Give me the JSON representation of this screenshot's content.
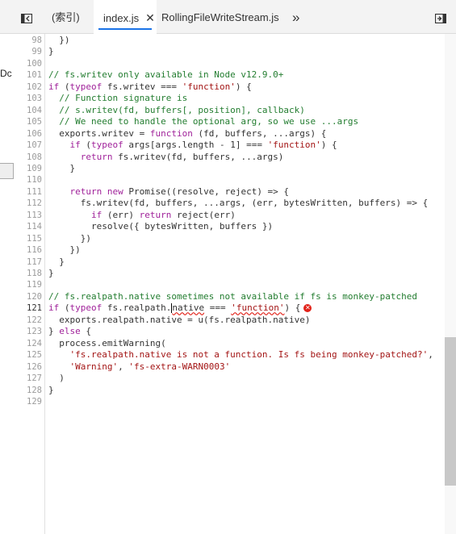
{
  "tabs": [
    {
      "label": "(索引)",
      "active": false
    },
    {
      "label": "index.js",
      "active": true
    },
    {
      "label": "RollingFileWriteStream.js",
      "active": false
    }
  ],
  "tab_overflow_glyph": "»",
  "left_panel_text": "Dc",
  "lines": [
    {
      "n": "98",
      "t": "  })"
    },
    {
      "n": "99",
      "t": "}"
    },
    {
      "n": "100",
      "t": ""
    },
    {
      "n": "101",
      "t": "// fs.writev only available in Node v12.9.0+"
    },
    {
      "n": "102",
      "t": "if (typeof fs.writev === 'function') {"
    },
    {
      "n": "103",
      "t": "  // Function signature is"
    },
    {
      "n": "104",
      "t": "  // s.writev(fd, buffers[, position], callback)"
    },
    {
      "n": "105",
      "t": "  // We need to handle the optional arg, so we use ...args"
    },
    {
      "n": "106",
      "t": "  exports.writev = function (fd, buffers, ...args) {"
    },
    {
      "n": "107",
      "t": "    if (typeof args[args.length - 1] === 'function') {"
    },
    {
      "n": "108",
      "t": "      return fs.writev(fd, buffers, ...args)"
    },
    {
      "n": "109",
      "t": "    }"
    },
    {
      "n": "110",
      "t": ""
    },
    {
      "n": "111",
      "t": "    return new Promise((resolve, reject) => {"
    },
    {
      "n": "112",
      "t": "      fs.writev(fd, buffers, ...args, (err, bytesWritten, buffers) => {"
    },
    {
      "n": "113",
      "t": "        if (err) return reject(err)"
    },
    {
      "n": "114",
      "t": "        resolve({ bytesWritten, buffers })"
    },
    {
      "n": "115",
      "t": "      })"
    },
    {
      "n": "116",
      "t": "    })"
    },
    {
      "n": "117",
      "t": "  }"
    },
    {
      "n": "118",
      "t": "}"
    },
    {
      "n": "119",
      "t": ""
    },
    {
      "n": "120",
      "t": "// fs.realpath.native sometimes not available if fs is monkey-patched"
    },
    {
      "n": "121",
      "t": "if (typeof fs.realpath.native === 'function') {"
    },
    {
      "n": "122",
      "t": "  exports.realpath.native = u(fs.realpath.native)"
    },
    {
      "n": "123",
      "t": "} else {"
    },
    {
      "n": "124",
      "t": "  process.emitWarning("
    },
    {
      "n": "125",
      "t": "    'fs.realpath.native is not a function. Is fs being monkey-patched?',"
    },
    {
      "n": "126",
      "t": "    'Warning', 'fs-extra-WARN0003'"
    },
    {
      "n": "127",
      "t": "  )"
    },
    {
      "n": "128",
      "t": "}"
    },
    {
      "n": "129",
      "t": ""
    }
  ],
  "current_line": "121",
  "error_line": "121",
  "colors": {
    "keyword": "#a0229a",
    "string": "#a31515",
    "comment": "#237d30",
    "error": "#e2231a",
    "tab_underline": "#1a73e8"
  },
  "icons": [
    "toggle-navigator-icon",
    "close-icon",
    "more-tabs-icon",
    "toggle-debugger-icon",
    "error-icon"
  ]
}
